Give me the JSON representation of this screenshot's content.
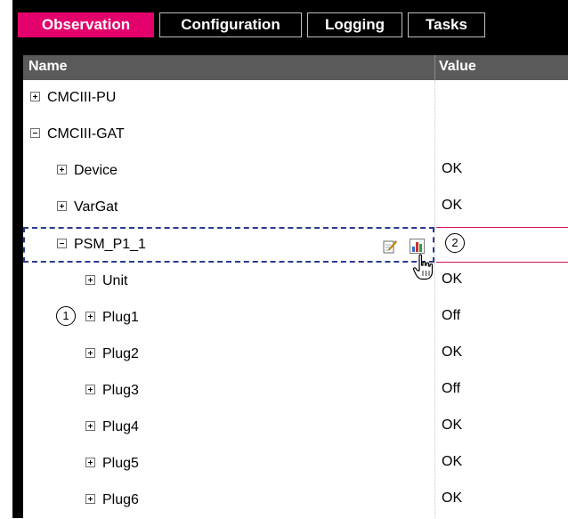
{
  "tabs": [
    {
      "label": "Observation",
      "active": true
    },
    {
      "label": "Configuration",
      "active": false
    },
    {
      "label": "Logging",
      "active": false
    },
    {
      "label": "Tasks",
      "active": false
    }
  ],
  "grid": {
    "headers": {
      "name": "Name",
      "value": "Value"
    },
    "rows": [
      {
        "label": "CMCIII-PU",
        "value": "",
        "expander": "plus",
        "level": 0
      },
      {
        "label": "CMCIII-GAT",
        "value": "",
        "expander": "minus",
        "level": 0
      },
      {
        "label": "Device",
        "value": "OK",
        "expander": "plus",
        "level": 1
      },
      {
        "label": "VarGat",
        "value": "OK",
        "expander": "plus",
        "level": 1
      },
      {
        "label": "PSM_P1_1",
        "value": "",
        "expander": "minus",
        "level": 1
      },
      {
        "label": "Unit",
        "value": "OK",
        "expander": "plus",
        "level": 2
      },
      {
        "label": "Plug1",
        "value": "Off",
        "expander": "plus",
        "level": 2
      },
      {
        "label": "Plug2",
        "value": "OK",
        "expander": "plus",
        "level": 2
      },
      {
        "label": "Plug3",
        "value": "Off",
        "expander": "plus",
        "level": 2
      },
      {
        "label": "Plug4",
        "value": "OK",
        "expander": "plus",
        "level": 2
      },
      {
        "label": "Plug5",
        "value": "OK",
        "expander": "plus",
        "level": 2
      },
      {
        "label": "Plug6",
        "value": "OK",
        "expander": "plus",
        "level": 2
      }
    ]
  },
  "callouts": {
    "one": "1",
    "two": "2"
  },
  "icons": {
    "edit": "edit-icon",
    "chart": "chart-icon",
    "cursor": "hand-pointer-icon"
  },
  "colors": {
    "active_tab": "#e4006b",
    "header": "#5a5a5a",
    "focus_border": "#2b3a91",
    "highlight": "#d4145a"
  }
}
